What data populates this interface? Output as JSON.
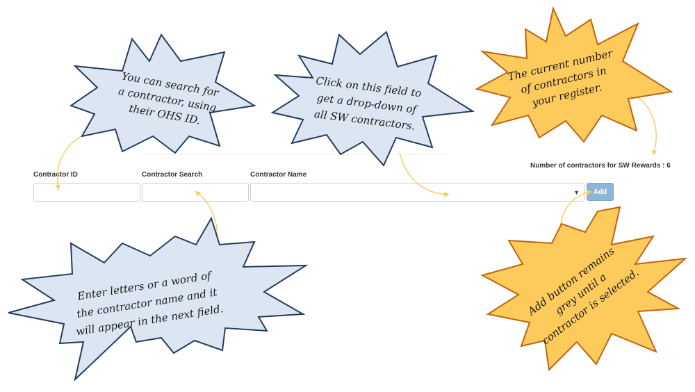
{
  "form": {
    "contractor_id_label": "Contractor ID",
    "contractor_search_label": "Contractor Search",
    "contractor_name_label": "Contractor Name",
    "contractor_id_value": "",
    "contractor_search_value": "",
    "contractor_name_selected": "",
    "add_label": "Add",
    "count_text": "Number of contractors for SW Rewards : 6"
  },
  "callouts": {
    "id_search": [
      "You can search for",
      "a contractor, using",
      "their OHS ID."
    ],
    "dropdown": [
      "Click on this field to",
      "get a drop-down of",
      "all SW contractors."
    ],
    "count": [
      "The current number",
      "of contractors in",
      "your register."
    ],
    "search": [
      "Enter letters or a word of",
      "the contractor name and it",
      "will appear in the next field."
    ],
    "add": [
      "Add button remains",
      "grey until a",
      "contractor is selected."
    ]
  },
  "colors": {
    "blue_fill": "#dce6f2",
    "blue_stroke": "#253c5e",
    "yellow_fill": "#fdcb5c",
    "yellow_stroke": "#c2630f",
    "arrow": "#f3cf6a",
    "button": "#8fb5d5"
  }
}
